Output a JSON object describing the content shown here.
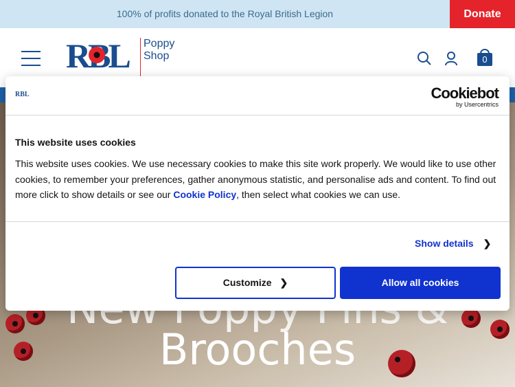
{
  "topbar": {
    "message": "100% of profits donated to the Royal British Legion",
    "donate_label": "Donate"
  },
  "header": {
    "logo_mark": "RBL",
    "logo_text_line1": "Poppy",
    "logo_text_line2": "Shop",
    "cart_count": "0",
    "icons": [
      "menu-icon",
      "search-icon",
      "account-icon",
      "basket-icon"
    ]
  },
  "hero": {
    "headline_line1": "New Poppy Pins &",
    "headline_line2": "Brooches"
  },
  "cookie": {
    "logo_mark": "RBL",
    "provider_name": "Cookiebot",
    "provider_by": "by Usercentrics",
    "title": "This website uses cookies",
    "body_before_link": "This website uses cookies. We use necessary cookies to make this site work properly. We would like to use other cookies, to remember your preferences, gather anonymous statistic, and personalise ads and content. To find out more click to show details or see our ",
    "link_text": "Cookie Policy",
    "body_after_link": ", then select what cookies we can use.",
    "show_details_label": "Show details",
    "customize_label": "Customize",
    "allow_all_label": "Allow all cookies"
  },
  "colors": {
    "topbar_bg": "#cfe5f3",
    "donate_bg": "#e4232b",
    "brand_blue": "#1a4d8f",
    "cookie_accent": "#1032cf"
  }
}
